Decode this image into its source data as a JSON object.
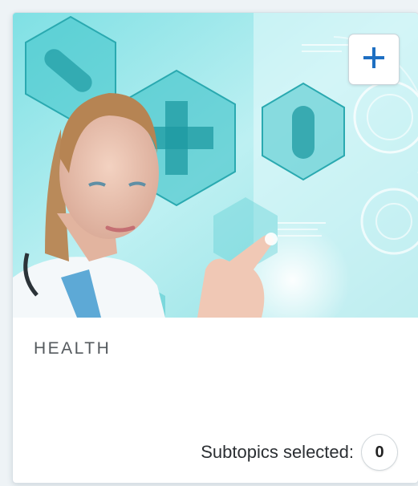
{
  "topic_card": {
    "title": "HEALTH",
    "image_subject": "doctor-touching-medical-hologram",
    "add_button_icon": "plus-icon",
    "subtopics_label": "Subtopics selected:",
    "subtopics_count": "0"
  },
  "colors": {
    "accent": "#1e6fc2",
    "hero_tint": "#5ed3d8",
    "title_text": "#555a5e"
  }
}
